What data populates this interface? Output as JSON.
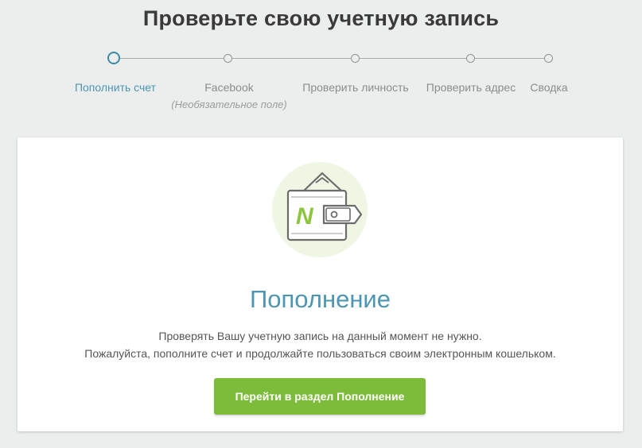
{
  "page": {
    "title": "Проверьте свою учетную запись"
  },
  "stepper": {
    "steps": [
      {
        "label": "Пополнить счет",
        "active": true
      },
      {
        "label": "Facebook",
        "sub": "(Необязательное поле)"
      },
      {
        "label": "Проверить личность"
      },
      {
        "label": "Проверить адрес"
      },
      {
        "label": "Сводка"
      }
    ]
  },
  "card": {
    "icon": "wallet-icon",
    "heading": "Пополнение",
    "line1": "Проверять Вашу учетную запись на данный момент не нужно.",
    "line2": "Пожалуйста, пополните счет и продолжайте пользоваться своим электронным кошельком.",
    "button": "Перейти в раздел Пополнение"
  },
  "colors": {
    "accent": "#4d96b3",
    "button": "#7dbc3a",
    "brand_green": "#8cc63f"
  }
}
